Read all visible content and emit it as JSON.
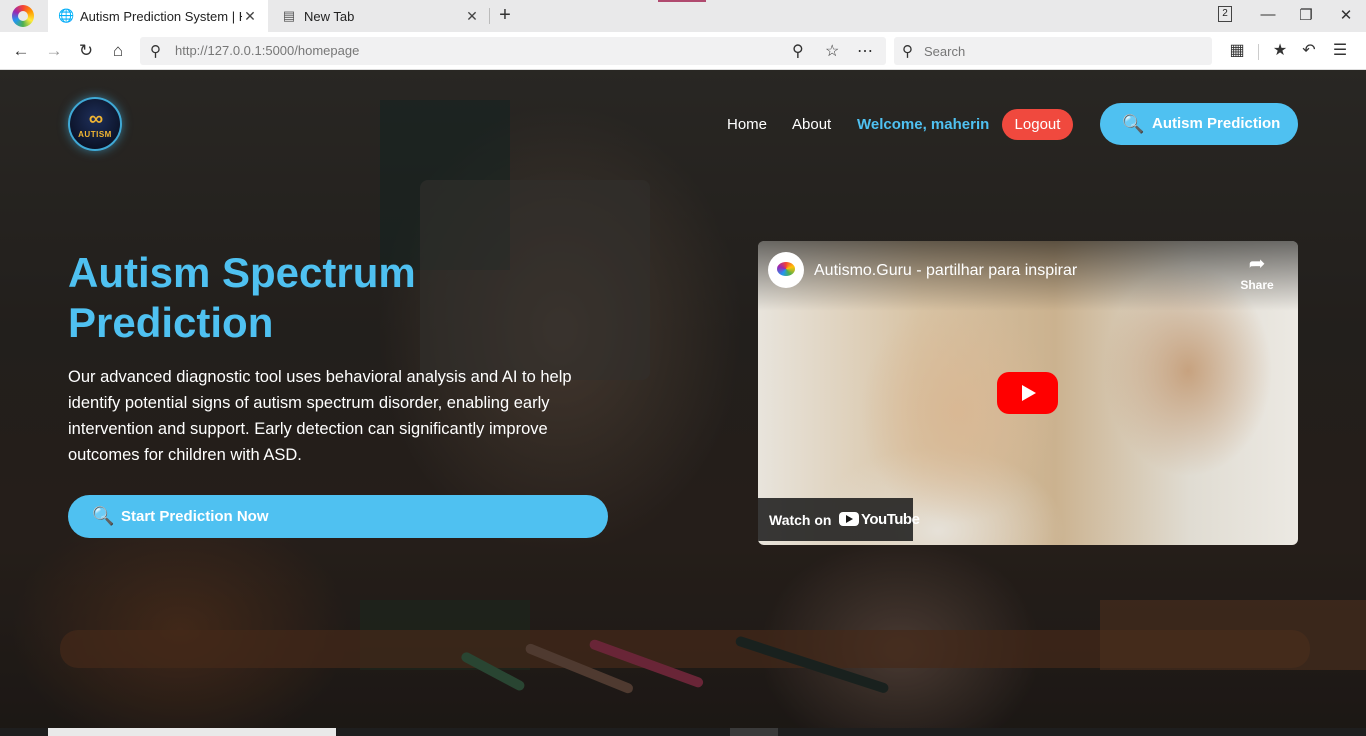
{
  "browser": {
    "tabs": [
      {
        "title": "Autism Prediction System | Ho",
        "icon": "globe-icon",
        "active": true
      },
      {
        "title": "New Tab",
        "icon": "newtab-icon",
        "active": false
      }
    ],
    "tab_count": "2",
    "url": "http://127.0.0.1:5000/homepage",
    "search_placeholder": "Search"
  },
  "site": {
    "logo_text": "AUTISM",
    "nav": {
      "home": "Home",
      "about": "About",
      "welcome": "Welcome, maherin",
      "logout": "Logout",
      "prediction": "Autism Prediction"
    },
    "hero": {
      "title": "Autism Spectrum Prediction",
      "description": "Our advanced diagnostic tool uses behavioral analysis and AI to help identify potential signs of autism spectrum disorder, enabling early intervention and support. Early detection can significantly improve outcomes for children with ASD.",
      "cta": "Start Prediction Now"
    },
    "video": {
      "title": "Autismo.Guru - partilhar para inspirar",
      "share": "Share",
      "watch_on": "Watch on",
      "youtube": "YouTube"
    }
  },
  "colors": {
    "accent": "#4fc1f1",
    "logout": "#f0493e",
    "youtube_red": "#ff0000"
  }
}
